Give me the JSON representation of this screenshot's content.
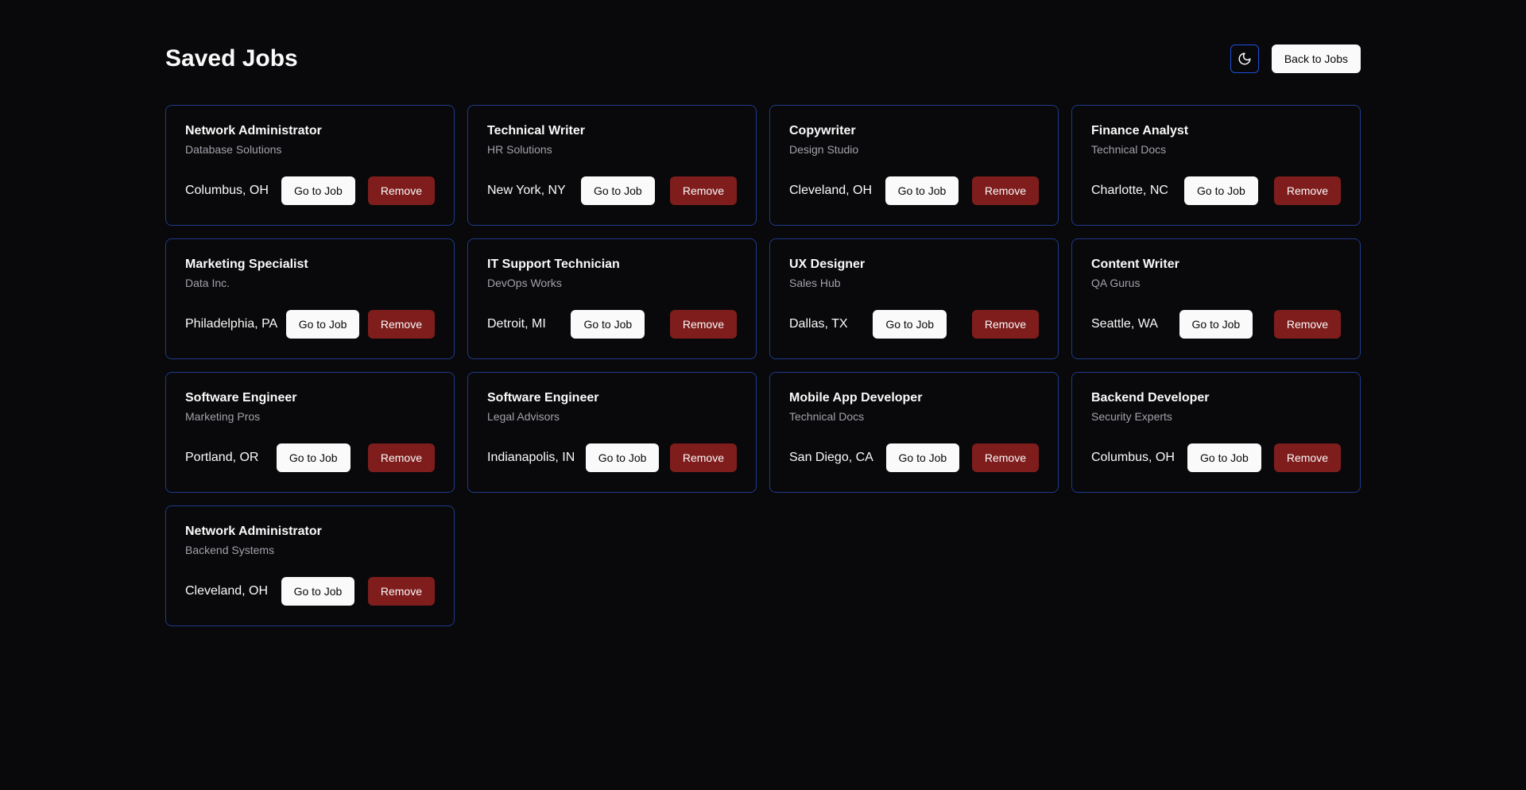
{
  "header": {
    "title": "Saved Jobs",
    "theme_toggle_icon": "moon-icon",
    "back_label": "Back to Jobs"
  },
  "colors": {
    "background": "#09090b",
    "card_border": "#1e3a8a",
    "remove_button": "#7f1d1d",
    "primary_button": "#fafafa"
  },
  "jobs": [
    {
      "title": "Network Administrator",
      "company": "Database Solutions",
      "location": "Columbus, OH",
      "goto_label": "Go to Job",
      "remove_label": "Remove"
    },
    {
      "title": "Technical Writer",
      "company": "HR Solutions",
      "location": "New York, NY",
      "goto_label": "Go to Job",
      "remove_label": "Remove"
    },
    {
      "title": "Copywriter",
      "company": "Design Studio",
      "location": "Cleveland, OH",
      "goto_label": "Go to Job",
      "remove_label": "Remove"
    },
    {
      "title": "Finance Analyst",
      "company": "Technical Docs",
      "location": "Charlotte, NC",
      "goto_label": "Go to Job",
      "remove_label": "Remove"
    },
    {
      "title": "Marketing Specialist",
      "company": "Data Inc.",
      "location": "Philadelphia, PA",
      "goto_label": "Go to Job",
      "remove_label": "Remove"
    },
    {
      "title": "IT Support Technician",
      "company": "DevOps Works",
      "location": "Detroit, MI",
      "goto_label": "Go to Job",
      "remove_label": "Remove"
    },
    {
      "title": "UX Designer",
      "company": "Sales Hub",
      "location": "Dallas, TX",
      "goto_label": "Go to Job",
      "remove_label": "Remove"
    },
    {
      "title": "Content Writer",
      "company": "QA Gurus",
      "location": "Seattle, WA",
      "goto_label": "Go to Job",
      "remove_label": "Remove"
    },
    {
      "title": "Software Engineer",
      "company": "Marketing Pros",
      "location": "Portland, OR",
      "goto_label": "Go to Job",
      "remove_label": "Remove"
    },
    {
      "title": "Software Engineer",
      "company": "Legal Advisors",
      "location": "Indianapolis, IN",
      "goto_label": "Go to Job",
      "remove_label": "Remove"
    },
    {
      "title": "Mobile App Developer",
      "company": "Technical Docs",
      "location": "San Diego, CA",
      "goto_label": "Go to Job",
      "remove_label": "Remove"
    },
    {
      "title": "Backend Developer",
      "company": "Security Experts",
      "location": "Columbus, OH",
      "goto_label": "Go to Job",
      "remove_label": "Remove"
    },
    {
      "title": "Network Administrator",
      "company": "Backend Systems",
      "location": "Cleveland, OH",
      "goto_label": "Go to Job",
      "remove_label": "Remove"
    }
  ]
}
